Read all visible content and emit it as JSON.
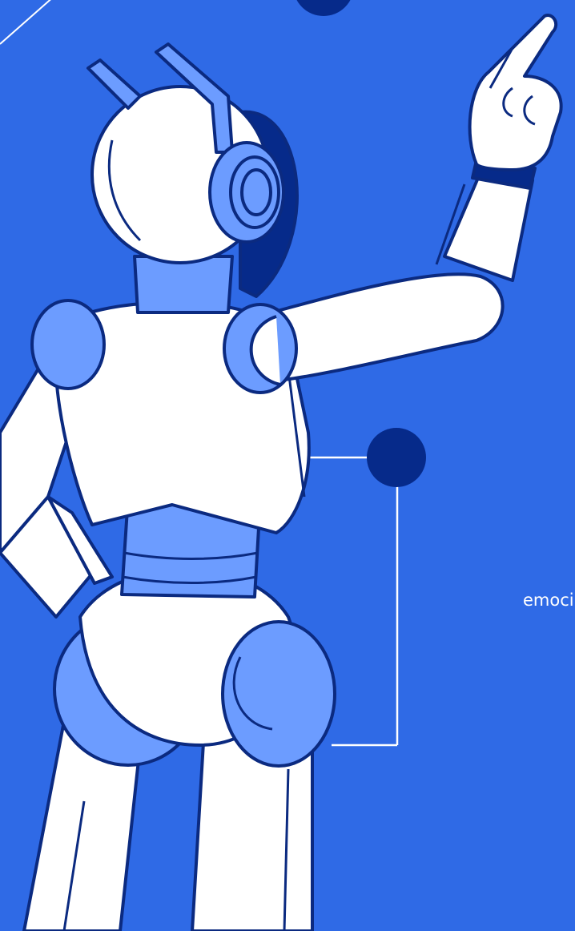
{
  "caption": {
    "text": "emoci"
  },
  "colors": {
    "background": "#2f6ae6",
    "outline": "#0b2a80",
    "body_fill": "#ffffff",
    "accent_fill": "#6c9cff",
    "dark_accent": "#062a8a",
    "connector_line": "#ffffff"
  },
  "illustration": {
    "subject": "robot-pointing-up",
    "icon": "robot-illustration"
  }
}
